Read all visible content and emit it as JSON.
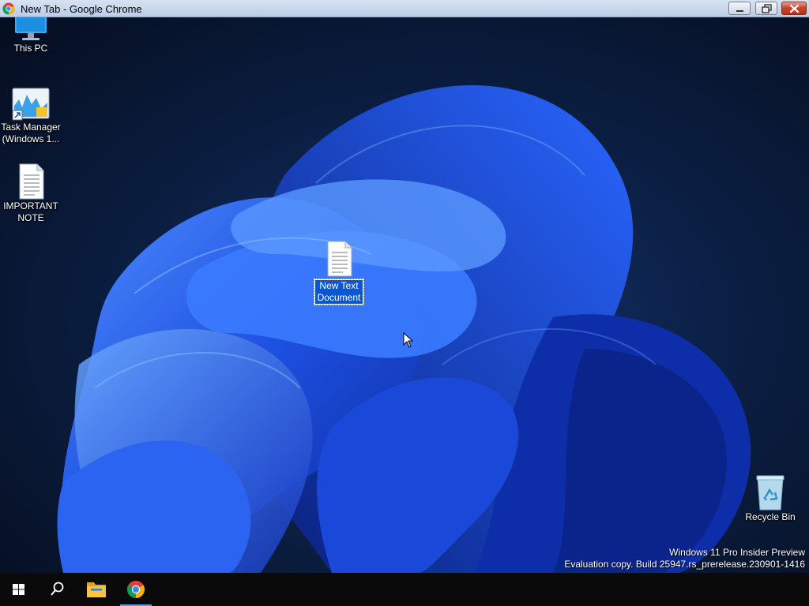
{
  "window": {
    "title": "New Tab - Google Chrome",
    "icon": "chrome-icon",
    "controls": [
      "minimize-icon",
      "restore-icon",
      "close-icon"
    ]
  },
  "desktop": {
    "icons": [
      {
        "label": "This PC",
        "icon": "monitor-icon"
      },
      {
        "label": "Task Manager (Windows 1...",
        "line1": "Task Manager",
        "line2": "(Windows 1...",
        "icon": "task-manager-icon"
      },
      {
        "label": "IMPORTANT NOTE",
        "line1": "IMPORTANT",
        "line2": "NOTE",
        "icon": "text-document-icon"
      },
      {
        "label": "New Text Document",
        "line1": "New Text",
        "line2": "Document",
        "icon": "text-document-icon",
        "state": "renaming"
      },
      {
        "label": "Recycle Bin",
        "icon": "recycle-bin-icon"
      }
    ],
    "watermark": {
      "line1": "Windows 11 Pro Insider Preview",
      "line2": "Evaluation copy. Build 25947.rs_prerelease.230901-1416"
    }
  },
  "taskbar": {
    "items": [
      {
        "name": "start",
        "icon": "windows-logo-icon"
      },
      {
        "name": "search",
        "icon": "search-icon"
      },
      {
        "name": "file-explorer",
        "icon": "folder-icon"
      },
      {
        "name": "google-chrome",
        "icon": "chrome-icon",
        "active": true
      }
    ]
  },
  "colors": {
    "selection": "#0b57d0",
    "taskbar": "#0a0a0a",
    "active_indicator": "#4f9cf0"
  }
}
